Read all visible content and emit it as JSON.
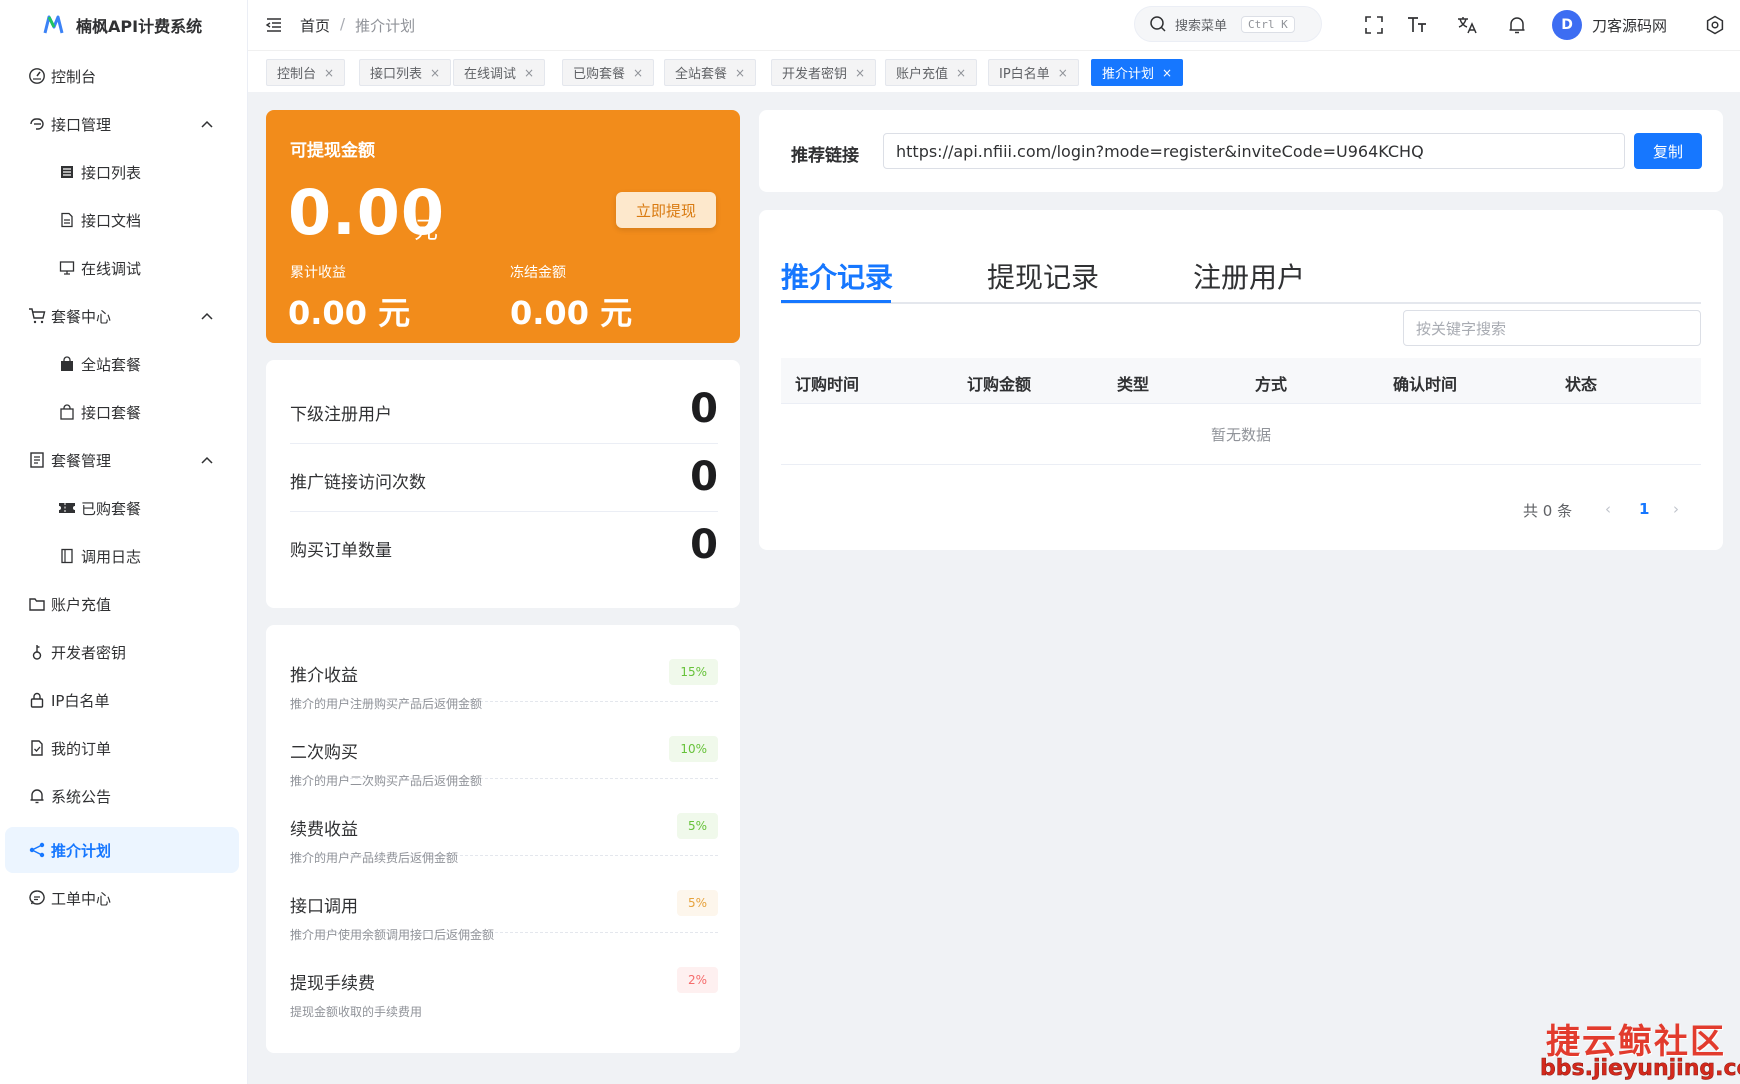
{
  "app": {
    "title": "楠枫API计费系统"
  },
  "sidebar": {
    "items": [
      {
        "label": "控制台",
        "icon": "dashboard-icon"
      },
      {
        "label": "接口管理",
        "icon": "api-icon"
      },
      {
        "label": "接口列表",
        "icon": "list-icon"
      },
      {
        "label": "接口文档",
        "icon": "document-icon"
      },
      {
        "label": "在线调试",
        "icon": "monitor-icon"
      },
      {
        "label": "套餐中心",
        "icon": "cart-icon"
      },
      {
        "label": "全站套餐",
        "icon": "bag-filled-icon"
      },
      {
        "label": "接口套餐",
        "icon": "bag-icon"
      },
      {
        "label": "套餐管理",
        "icon": "notebook-icon"
      },
      {
        "label": "已购套餐",
        "icon": "ticket-icon"
      },
      {
        "label": "调用日志",
        "icon": "log-icon"
      },
      {
        "label": "账户充值",
        "icon": "wallet-icon"
      },
      {
        "label": "开发者密钥",
        "icon": "key-icon"
      },
      {
        "label": "IP白名单",
        "icon": "lock-icon"
      },
      {
        "label": "我的订单",
        "icon": "order-icon"
      },
      {
        "label": "系统公告",
        "icon": "bell-icon"
      },
      {
        "label": "推介计划",
        "icon": "share-icon"
      },
      {
        "label": "工单中心",
        "icon": "chat-icon"
      }
    ]
  },
  "header": {
    "breadcrumb": [
      "首页",
      "推介计划"
    ],
    "breadcrumb_sep": "/",
    "search_placeholder": "搜索菜单",
    "search_shortcut": "Ctrl K",
    "avatar_letter": "D",
    "username": "刀客源码网"
  },
  "tabs": [
    "控制台",
    "接口列表",
    "在线调试",
    "已购套餐",
    "全站套餐",
    "开发者密钥",
    "账户充值",
    "IP白名单",
    "推介计划"
  ],
  "tab_close": "×",
  "balance": {
    "label": "可提现金额",
    "amount": "0.00",
    "unit": "元",
    "withdraw_button": "立即提现",
    "total_label": "累计收益",
    "total_value": "0.00 元",
    "frozen_label": "冻结金额",
    "frozen_value": "0.00 元"
  },
  "stats": [
    {
      "label": "下级注册用户",
      "value": "0"
    },
    {
      "label": "推广链接访问次数",
      "value": "0"
    },
    {
      "label": "购买订单数量",
      "value": "0"
    }
  ],
  "rates": [
    {
      "title": "推介收益",
      "desc": "推介的用户注册购买产品后返佣金额",
      "rate": "15%",
      "color": "#67c23a",
      "bg": "#f0f9eb"
    },
    {
      "title": "二次购买",
      "desc": "推介的用户二次购买产品后返佣金额",
      "rate": "10%",
      "color": "#67c23a",
      "bg": "#f0f9eb"
    },
    {
      "title": "续费收益",
      "desc": "推介的用户产品续费后返佣金额",
      "rate": "5%",
      "color": "#67c23a",
      "bg": "#f0f9eb"
    },
    {
      "title": "接口调用",
      "desc": "推介用户使用余额调用接口后返佣金额",
      "rate": "5%",
      "color": "#e6a23c",
      "bg": "#fdf6ec"
    },
    {
      "title": "提现手续费",
      "desc": "提现金额收取的手续费用",
      "rate": "2%",
      "color": "#f56c6c",
      "bg": "#fef0f0"
    }
  ],
  "referral": {
    "label": "推荐链接",
    "url": "https://api.nfiii.com/login?mode=register&inviteCode=U964KCHQ",
    "copy_button": "复制"
  },
  "records": {
    "tabs": [
      "推介记录",
      "提现记录",
      "注册用户"
    ],
    "search_placeholder": "按关键字搜索",
    "columns": [
      "订购时间",
      "订购金额",
      "类型",
      "方式",
      "确认时间",
      "状态"
    ],
    "empty_text": "暂无数据",
    "total_text": "共 0 条",
    "page": "1",
    "prev": "‹",
    "next": "›"
  },
  "watermark": {
    "line1": "捷云鲸社区",
    "line2": "bbs.jieyunjing.com"
  }
}
